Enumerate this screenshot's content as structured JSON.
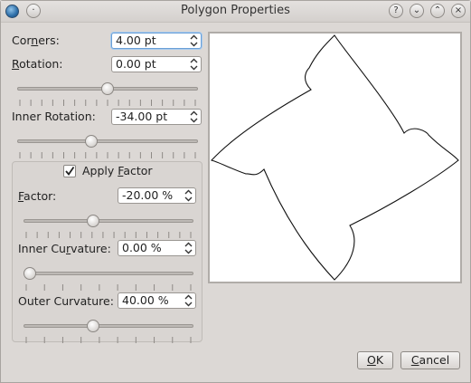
{
  "window": {
    "title": "Polygon Properties",
    "titlebar_buttons": [
      "?",
      "⌄",
      "⌃",
      "×"
    ]
  },
  "corners": {
    "label_pre": "Cor",
    "label_u": "n",
    "label_post": "ers:",
    "value": "4.00 pt"
  },
  "rotation": {
    "label_pre": "",
    "label_u": "R",
    "label_post": "otation:",
    "value": "0.00 pt",
    "slider_level": 0.5
  },
  "inner_rotation": {
    "label": "Inner Rotation:",
    "value": "-34.00 pt",
    "slider_level": 0.405
  },
  "apply_factor": {
    "label_pre": "Apply ",
    "label_u": "F",
    "label_post": "actor",
    "checked": true
  },
  "factor": {
    "label_pre": "",
    "label_u": "F",
    "label_post": "actor:",
    "value": "-20.00 %",
    "slider_level": 0.4
  },
  "inner_curvature": {
    "label_pre": "Inner Cu",
    "label_u": "r",
    "label_post": "vature:",
    "value": "0.00 %",
    "slider_level": 0.0
  },
  "outer_curvature": {
    "label": "Outer Curvature:",
    "value": "40.00 %",
    "slider_level": 0.4
  },
  "buttons": {
    "ok_u": "O",
    "ok_rest": "K",
    "cancel_u": "C",
    "cancel_rest": "ancel"
  },
  "icons": {
    "app": "app-globe-icon",
    "spin": "spin-arrows-icon",
    "check": "checkmark-icon"
  }
}
